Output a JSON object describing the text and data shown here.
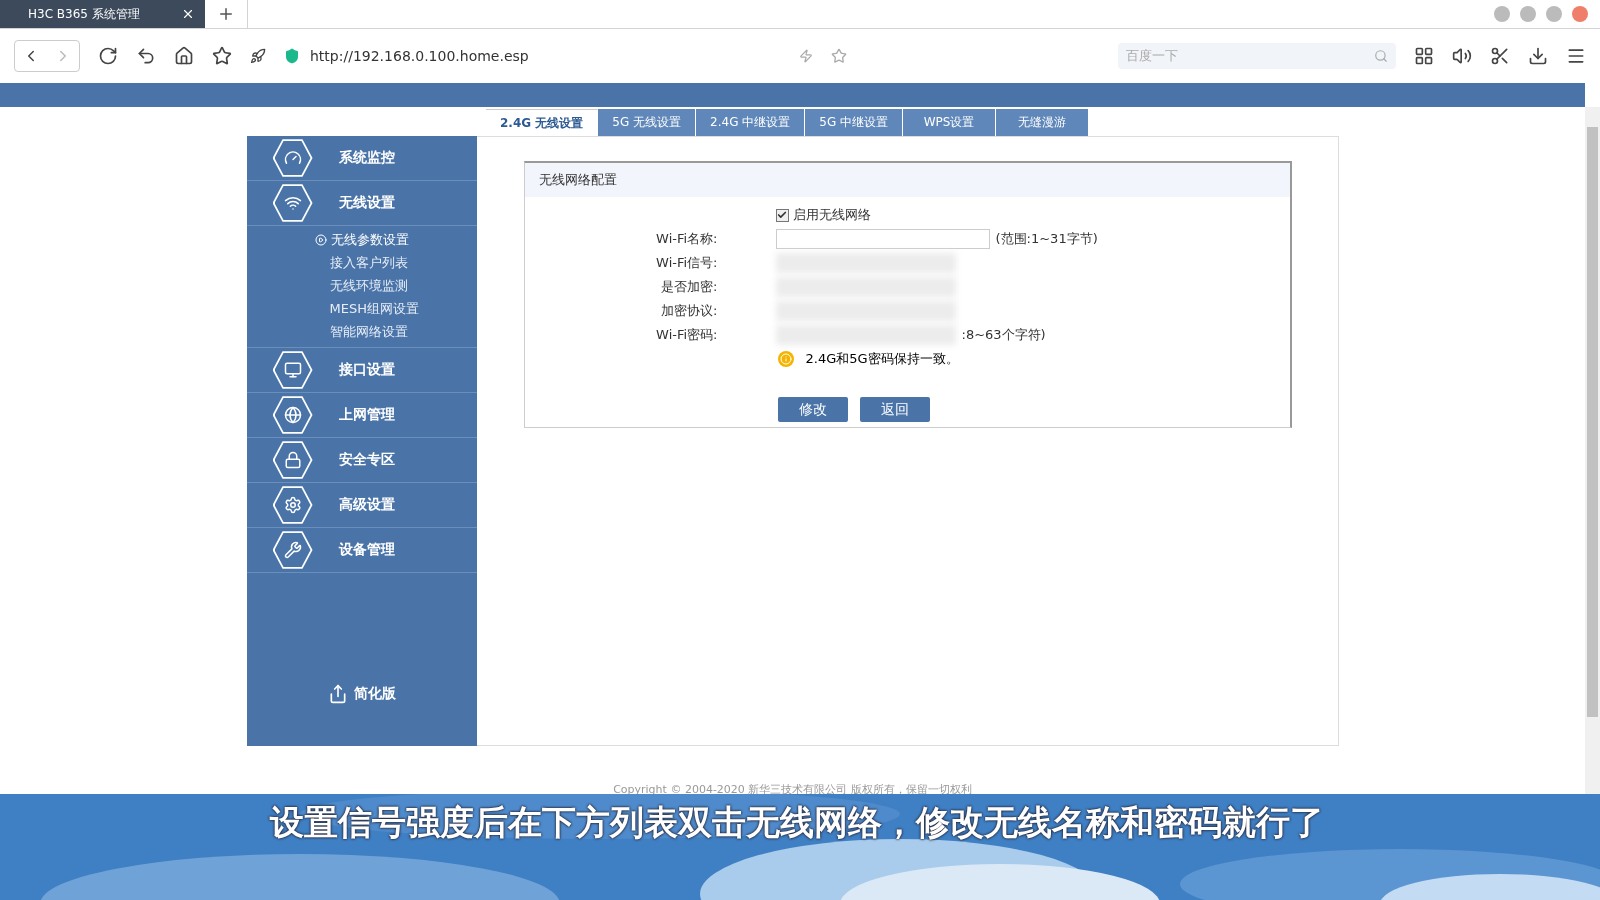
{
  "browser": {
    "tab_title": "H3C B365 系统管理",
    "url": "http://192.168.0.100.home.esp",
    "search_placeholder": "百度一下"
  },
  "tabs": [
    {
      "label": "2.4G 无线设置",
      "selected": true
    },
    {
      "label": "5G 无线设置",
      "selected": false
    },
    {
      "label": "2.4G 中继设置",
      "selected": false
    },
    {
      "label": "5G 中继设置",
      "selected": false
    },
    {
      "label": "WPS设置",
      "selected": false
    },
    {
      "label": "无缝漫游",
      "selected": false
    }
  ],
  "sidebar": {
    "items": [
      {
        "label": "系统监控"
      },
      {
        "label": "无线设置",
        "children": [
          {
            "label": "无线参数设置",
            "selected": true
          },
          {
            "label": "接入客户列表",
            "selected": false
          },
          {
            "label": "无线环境监测",
            "selected": false
          },
          {
            "label": "MESH组网设置",
            "selected": false
          },
          {
            "label": "智能网络设置",
            "selected": false
          }
        ]
      },
      {
        "label": "接口设置"
      },
      {
        "label": "上网管理"
      },
      {
        "label": "安全专区"
      },
      {
        "label": "高级设置"
      },
      {
        "label": "设备管理"
      }
    ],
    "simple_mode": "简化版"
  },
  "panel": {
    "title": "无线网络配置",
    "enable": {
      "label": "启用无线网络",
      "checked": true
    },
    "fields": [
      {
        "label": "Wi-Fi名称:",
        "kind": "input",
        "note": "(范围:1~31字节)"
      },
      {
        "label": "Wi-Fi信号:",
        "kind": "blurred"
      },
      {
        "label": "是否加密:",
        "kind": "blurred"
      },
      {
        "label": "加密协议:",
        "kind": "blurred"
      },
      {
        "label": "Wi-Fi密码:",
        "kind": "blurred",
        "note": ":8~63个字符)"
      }
    ],
    "warning": "2.4G和5G密码保持一致。",
    "buttons": [
      "修改",
      "返回"
    ]
  },
  "copyright": "Copyright © 2004-2020 新华三技术有限公司 版权所有，保留一切权利",
  "caption": "设置信号强度后在下方列表双击无线网络，修改无线名称和密码就行了"
}
